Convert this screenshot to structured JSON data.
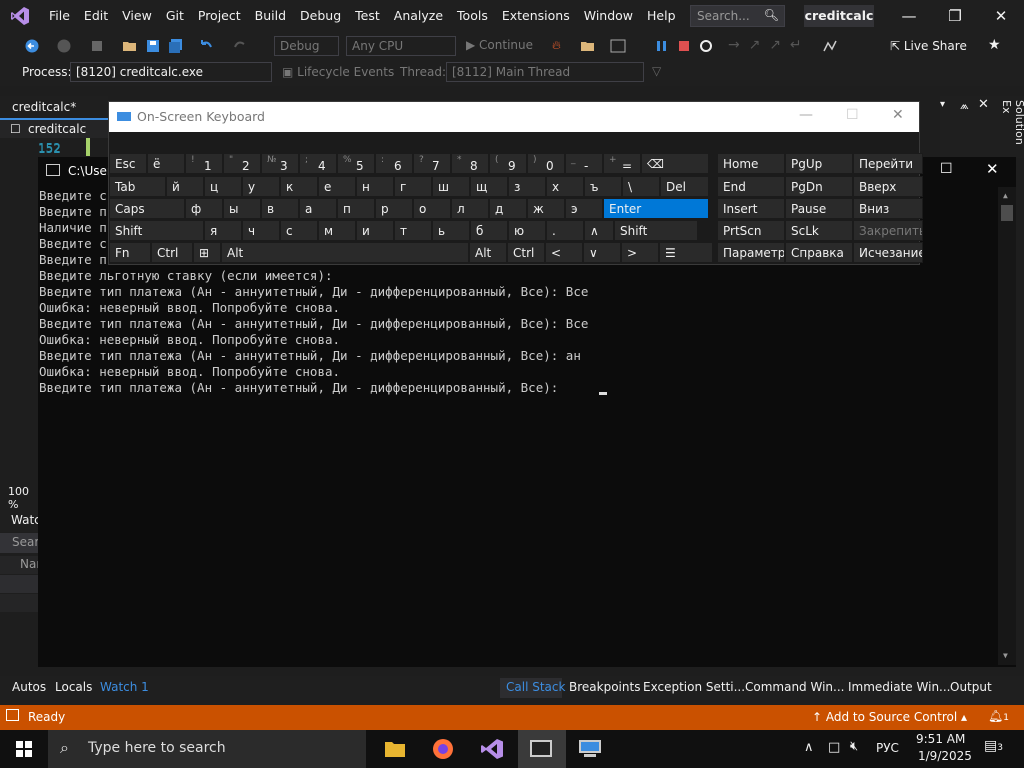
{
  "vs": {
    "menu": [
      "File",
      "Edit",
      "View",
      "Git",
      "Project",
      "Build",
      "Debug",
      "Test",
      "Analyze",
      "Tools",
      "Extensions",
      "Window",
      "Help"
    ],
    "search_placeholder": "Search...",
    "solution_name": "creditcalc",
    "config": "Debug",
    "platform": "Any CPU",
    "continue_label": "Continue",
    "live_share": "Live Share",
    "process_label": "Process:",
    "process_value": "[8120] creditcalc.exe",
    "lifecycle_label": "Lifecycle Events",
    "thread_label": "Thread:",
    "thread_value": "[8112] Main Thread",
    "doc_tab": "creditcalc*",
    "class_dropdown": "creditcalc",
    "line_number": "152",
    "zoom": "100 %",
    "side_watch": "Watc",
    "side_search": "Searc",
    "side_name": "Nar",
    "solution_explorer": "Solution Ex"
  },
  "console": {
    "title": "C:\\User",
    "lines": [
      "Введите с",
      "Введите п",
      "Наличие п",
      "Введите с",
      "Введите п",
      "Введите льготную ставку (если имеется):",
      "Введите тип платежа (Ан - аннуитетный, Ди - дифференцированный, Все): Все",
      "Ошибка: неверный ввод. Попробуйте снова.",
      "Введите тип платежа (Ан - аннуитетный, Ди - дифференцированный, Все): Все",
      "Ошибка: неверный ввод. Попробуйте снова.",
      "Введите тип платежа (Ан - аннуитетный, Ди - дифференцированный, Все): ан",
      "Ошибка: неверный ввод. Попробуйте снова.",
      "Введите тип платежа (Ан - аннуитетный, Ди - дифференцированный, Все): "
    ]
  },
  "osk": {
    "title": "On-Screen Keyboard",
    "row1": [
      "Esc",
      "ё",
      "1",
      "2",
      "3",
      "4",
      "5",
      "6",
      "7",
      "8",
      "9",
      "0",
      "-",
      "="
    ],
    "row1_sub": [
      "",
      "",
      "!",
      "\"",
      "№",
      ";",
      "%",
      ":",
      "?",
      "*",
      "(",
      ")",
      "_",
      "+"
    ],
    "row2": [
      "Tab",
      "й",
      "ц",
      "у",
      "к",
      "е",
      "н",
      "г",
      "ш",
      "щ",
      "з",
      "х",
      "ъ",
      "\\",
      "Del"
    ],
    "row3": [
      "Caps",
      "ф",
      "ы",
      "в",
      "а",
      "п",
      "р",
      "о",
      "л",
      "д",
      "ж",
      "э",
      "Enter"
    ],
    "row4": [
      "Shift",
      "я",
      "ч",
      "с",
      "м",
      "и",
      "т",
      "ь",
      "б",
      "ю",
      ".",
      "Shift"
    ],
    "row5": [
      "Fn",
      "Ctrl",
      "Alt",
      "Alt",
      "Ctrl"
    ],
    "nav": [
      [
        "Home",
        "PgUp",
        "Перейти"
      ],
      [
        "End",
        "PgDn",
        "Вверх"
      ],
      [
        "Insert",
        "Pause",
        "Вниз"
      ],
      [
        "PrtScn",
        "ScLk",
        "Закрепить"
      ],
      [
        "Параметры",
        "Справка",
        "Исчезание"
      ]
    ]
  },
  "bottom_left_tabs": [
    "Autos",
    "Locals",
    "Watch 1"
  ],
  "bottom_right_tabs": [
    "Call Stack",
    "Breakpoints",
    "Exception Setti...",
    "Command Win...",
    "Immediate Win...",
    "Output"
  ],
  "status": {
    "ready": "Ready",
    "source_control": "Add to Source Control",
    "notif_count": "1"
  },
  "taskbar": {
    "search_placeholder": "Type here to search",
    "lang": "РУС",
    "time": "9:51 AM",
    "date": "1/9/2025",
    "notif_count": "3"
  },
  "colors": {
    "accent": "#0078d7",
    "status": "#ca5100"
  }
}
